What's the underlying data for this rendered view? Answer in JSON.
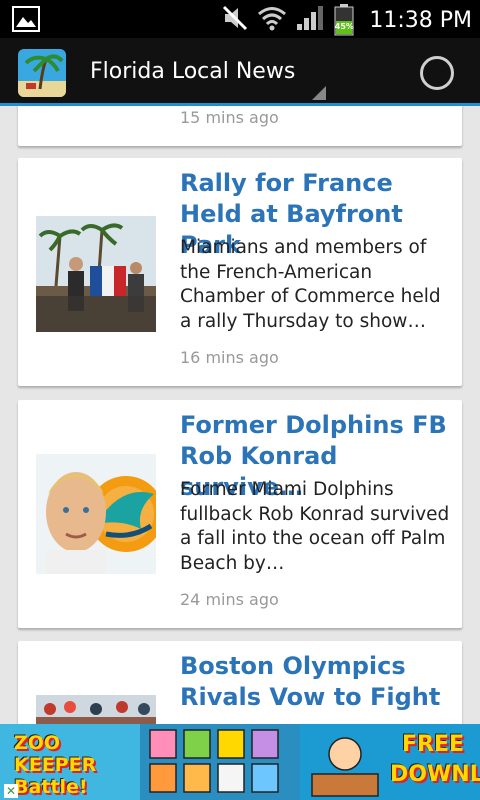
{
  "status_bar": {
    "time": "11:38 PM",
    "battery_percent": "45%",
    "icons": [
      "picture-icon",
      "mute-icon",
      "wifi-icon",
      "signal-icon",
      "battery-icon"
    ]
  },
  "action_bar": {
    "title": "Florida Local News",
    "icons": [
      "app-logo-icon",
      "dropdown-caret-icon",
      "refresh-icon"
    ]
  },
  "feed": {
    "items": [
      {
        "title": "",
        "description": "",
        "time": "15 mins ago"
      },
      {
        "title": "Rally for France Held at Bayfront Park",
        "description": "Miamians and members of the French-American Chamber of Commerce held a rally Thursday to show…",
        "time": "16 mins ago"
      },
      {
        "title": "Former Dolphins FB Rob Konrad survive…",
        "description": "Former Miami Dolphins fullback Rob Konrad survived a fall into the ocean off Palm Beach by…",
        "time": "24 mins ago"
      },
      {
        "title": "Boston Olympics Rivals Vow to Fight",
        "description": "",
        "time": ""
      }
    ]
  },
  "ad_banner": {
    "left_text": "ZOO KEEPER Battle!",
    "right_text": "FREE DOWNLOAD",
    "colors": {
      "background": "#13a4d8",
      "accent_yellow": "#ffd800",
      "accent_red": "#e0202a"
    }
  },
  "colors": {
    "title_blue": "#2b74b8",
    "action_bar_accent": "#1e8fd0",
    "timestamp_gray": "#999999"
  }
}
